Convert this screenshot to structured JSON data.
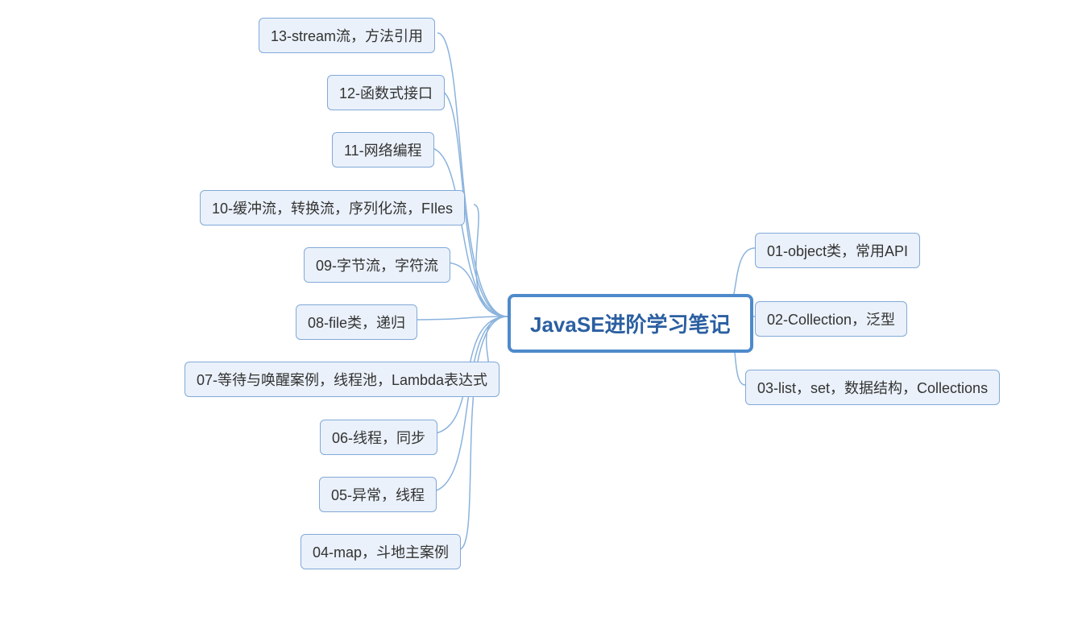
{
  "root": {
    "label": "JavaSE进阶学习笔记"
  },
  "leftNodes": [
    {
      "label": "13-stream流，方法引用"
    },
    {
      "label": "12-函数式接口"
    },
    {
      "label": "11-网络编程"
    },
    {
      "label": "10-缓冲流，转换流，序列化流，FIles"
    },
    {
      "label": "09-字节流，字符流"
    },
    {
      "label": "08-file类，递归"
    },
    {
      "label": "07-等待与唤醒案例，线程池，Lambda表达式"
    },
    {
      "label": "06-线程，同步"
    },
    {
      "label": "05-异常，线程"
    },
    {
      "label": "04-map，斗地主案例"
    }
  ],
  "rightNodes": [
    {
      "label": "01-object类，常用API"
    },
    {
      "label": "02-Collection，泛型"
    },
    {
      "label": "03-list，set，数据结构，Collections"
    }
  ]
}
